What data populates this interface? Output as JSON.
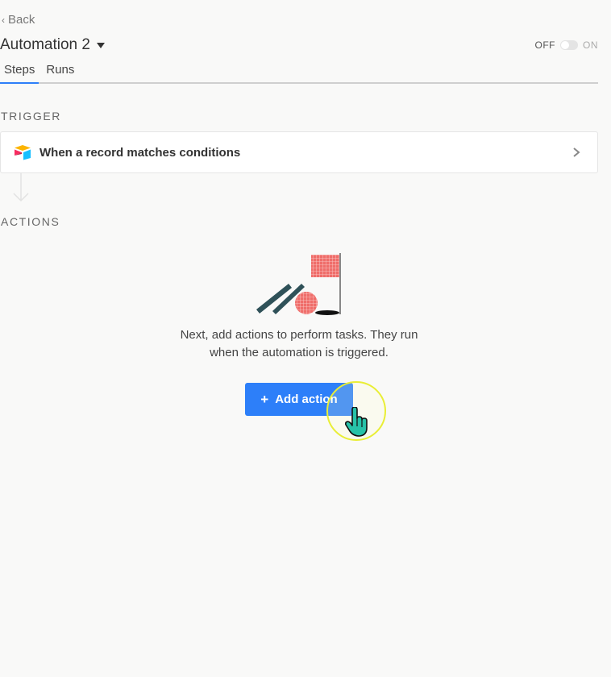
{
  "header": {
    "back_label": "Back",
    "title": "Automation 2",
    "toggle_off": "OFF",
    "toggle_on": "ON",
    "toggle_state": "off"
  },
  "tabs": [
    {
      "label": "Steps",
      "active": true
    },
    {
      "label": "Runs",
      "active": false
    }
  ],
  "trigger": {
    "section_label": "TRIGGER",
    "card_label": "When a record matches conditions",
    "icon": "airtable-logo-icon"
  },
  "actions": {
    "section_label": "ACTIONS",
    "empty_line1": "Next, add actions to perform tasks. They run",
    "empty_line2": "when the automation is triggered.",
    "add_button_plus": "+",
    "add_button_label": "Add action"
  },
  "colors": {
    "accent": "#2d7ff9",
    "background": "#f9f9f8",
    "illustration_dark": "#2f5158",
    "illustration_red": "#ef6d6a",
    "cursor_ring": "#e9ee36"
  }
}
